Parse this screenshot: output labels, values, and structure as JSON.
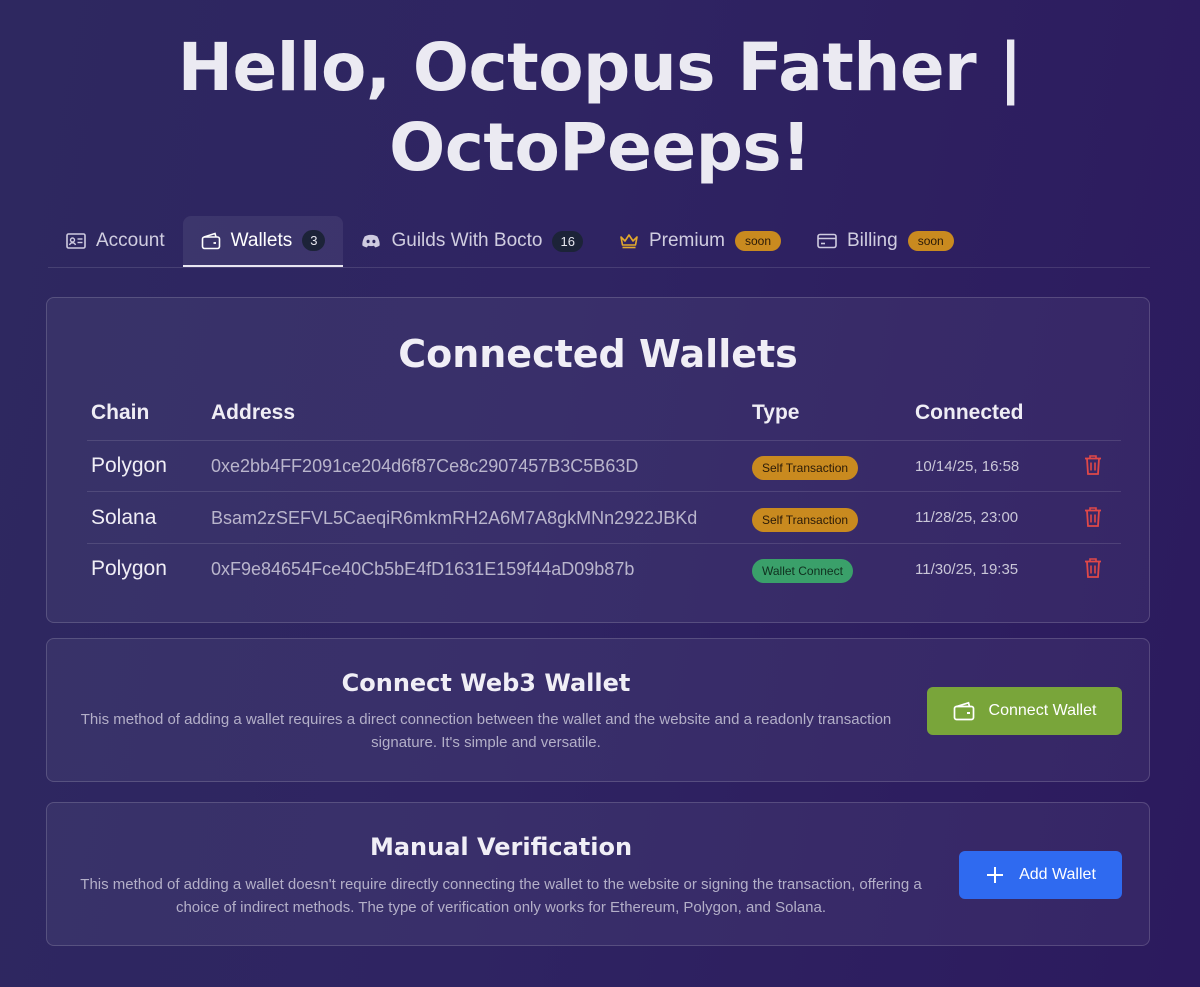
{
  "header": {
    "title": "Hello, Octopus Father | OctoPeeps!"
  },
  "tabs": [
    {
      "label": "Account",
      "icon": "id-card-icon"
    },
    {
      "label": "Wallets",
      "icon": "wallet-icon",
      "badge": "3"
    },
    {
      "label": "Guilds With Bocto",
      "icon": "discord-icon",
      "badge": "16"
    },
    {
      "label": "Premium",
      "icon": "crown-icon",
      "badge": "soon"
    },
    {
      "label": "Billing",
      "icon": "credit-card-icon",
      "badge": "soon"
    }
  ],
  "connected_wallets": {
    "title": "Connected Wallets",
    "columns": {
      "chain": "Chain",
      "address": "Address",
      "type": "Type",
      "connected": "Connected"
    },
    "rows": [
      {
        "chain": "Polygon",
        "address": "0xe2bb4FF2091ce204d6f87Ce8c2907457B3C5B63D",
        "type": "Self Transaction",
        "connected": "10/14/25, 16:58"
      },
      {
        "chain": "Solana",
        "address": "Bsam2zSEFVL5CaeqiR6mkmRH2A6M7A8gkMNn2922JBKd",
        "type": "Self Transaction",
        "connected": "11/28/25, 23:00"
      },
      {
        "chain": "Polygon",
        "address": "0xF9e84654Fce40Cb5bE4fD1631E159f44aD09b87b",
        "type": "Wallet Connect",
        "connected": "11/30/25, 19:35"
      }
    ]
  },
  "web3": {
    "title": "Connect Web3 Wallet",
    "description": "This method of adding a wallet requires a direct connection between the wallet and the website and a readonly transaction signature. It's simple and versatile.",
    "button_label": "Connect Wallet"
  },
  "manual": {
    "title": "Manual Verification",
    "description": "This method of adding a wallet doesn't require directly connecting the wallet to the website or signing the transaction, offering a choice of indirect methods. The type of verification only works for Ethereum, Polygon, and Solana.",
    "button_label": "Add Wallet"
  },
  "colors": {
    "accent_green": "#79a53a",
    "accent_blue": "#2f6af0",
    "badge_orange": "#c98a1f",
    "badge_green": "#3aa06a",
    "delete_red": "#e04848"
  }
}
